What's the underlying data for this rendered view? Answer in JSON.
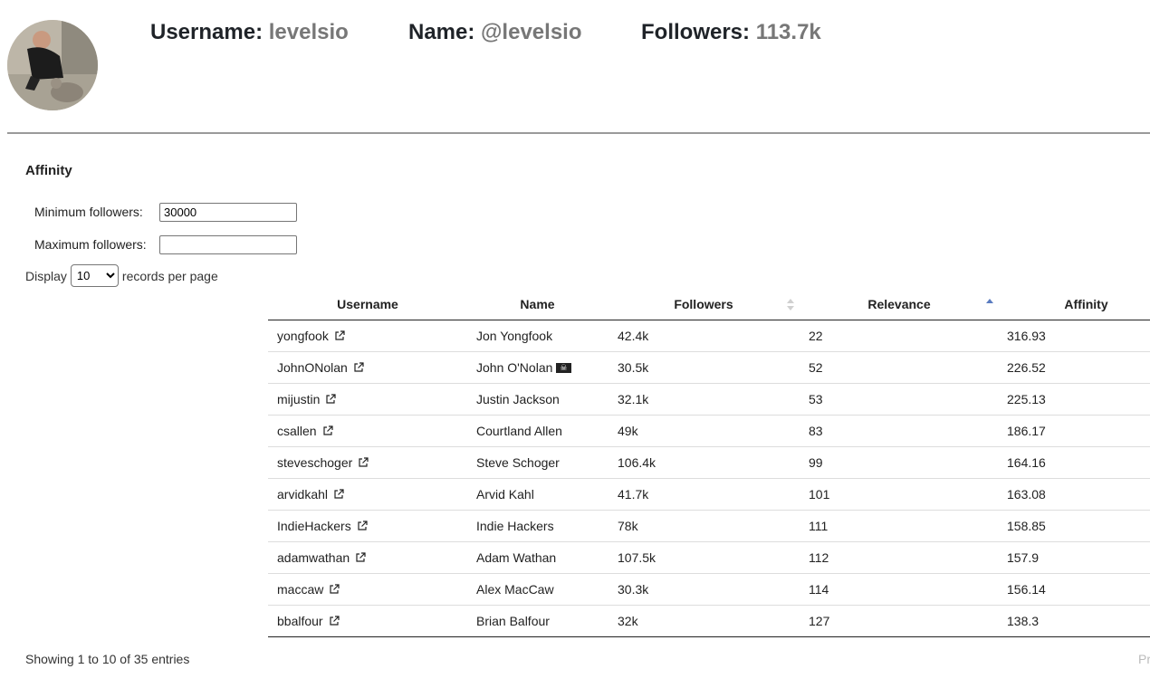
{
  "profile": {
    "username_label": "Username:",
    "username_value": "levelsio",
    "name_label": "Name:",
    "name_value": "@levelsio",
    "followers_label": "Followers:",
    "followers_value": "113.7k"
  },
  "section_title": "Affinity",
  "filters": {
    "min_label": "Minimum followers:",
    "min_value": "30000",
    "max_label": "Maximum followers:",
    "max_value": ""
  },
  "display": {
    "prefix": "Display",
    "value": "10",
    "options": [
      "10"
    ],
    "suffix": "records per page"
  },
  "table": {
    "columns": [
      "Username",
      "Name",
      "Followers",
      "Relevance",
      "Affinity"
    ],
    "sorted_column": "Relevance",
    "sort_direction": "ascending",
    "rows": [
      {
        "username": "yongfook",
        "name": "Jon Yongfook",
        "followers": "42.4k",
        "relevance": "22",
        "affinity": "316.93"
      },
      {
        "username": "JohnONolan",
        "name": "John O'Nolan",
        "name_icon": "pirate-flag-icon",
        "followers": "30.5k",
        "relevance": "52",
        "affinity": "226.52"
      },
      {
        "username": "mijustin",
        "name": "Justin Jackson",
        "followers": "32.1k",
        "relevance": "53",
        "affinity": "225.13"
      },
      {
        "username": "csallen",
        "name": "Courtland Allen",
        "followers": "49k",
        "relevance": "83",
        "affinity": "186.17"
      },
      {
        "username": "steveschoger",
        "name": "Steve Schoger",
        "followers": "106.4k",
        "relevance": "99",
        "affinity": "164.16"
      },
      {
        "username": "arvidkahl",
        "name": "Arvid Kahl",
        "followers": "41.7k",
        "relevance": "101",
        "affinity": "163.08"
      },
      {
        "username": "IndieHackers",
        "name": "Indie Hackers",
        "followers": "78k",
        "relevance": "111",
        "affinity": "158.85"
      },
      {
        "username": "adamwathan",
        "name": "Adam Wathan",
        "followers": "107.5k",
        "relevance": "112",
        "affinity": "157.9"
      },
      {
        "username": "maccaw",
        "name": "Alex MacCaw",
        "followers": "30.3k",
        "relevance": "114",
        "affinity": "156.14"
      },
      {
        "username": "bbalfour",
        "name": "Brian Balfour",
        "followers": "32k",
        "relevance": "127",
        "affinity": "138.3"
      }
    ]
  },
  "footer": {
    "info": "Showing 1 to 10 of 35 entries",
    "prev_label": "Pr"
  },
  "colors": {
    "sort_active": "#5a7cc0",
    "sort_inactive": "#d0d0d0",
    "muted_value": "#777777"
  }
}
